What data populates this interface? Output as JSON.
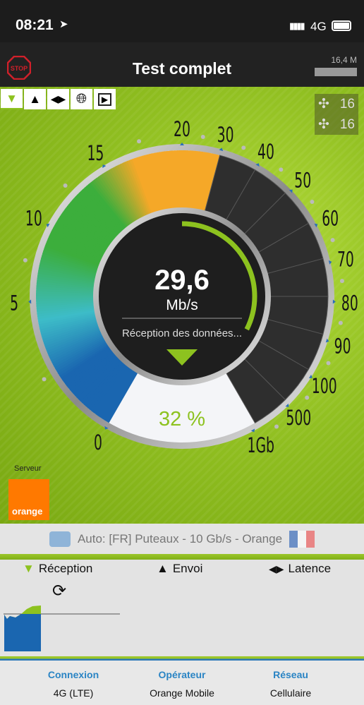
{
  "status_bar": {
    "time": "08:21",
    "network": "4G"
  },
  "header": {
    "title": "Test complet",
    "stop_label": "STOP",
    "data_used": "16,4 M"
  },
  "toolbar": {
    "icons": [
      "download-icon",
      "upload-icon",
      "latency-icon",
      "globe-icon",
      "video-icon"
    ],
    "active": "download-icon"
  },
  "counters": {
    "download_threads": "16",
    "upload_threads": "16"
  },
  "gauge": {
    "speed": "29,6",
    "unit": "Mb/s",
    "status": "Réception des données...",
    "progress": "32 %",
    "progress_fraction": 0.32,
    "scale_labels": [
      "0",
      "5",
      "10",
      "15",
      "20",
      "30",
      "40",
      "50",
      "60",
      "70",
      "80",
      "90",
      "100",
      "500",
      "1Gb"
    ],
    "colors": {
      "blue": "#1a66b0",
      "teal": "#3dbcc8",
      "green": "#3cae3c",
      "orange": "#f5a828",
      "dark": "#2e2e2e",
      "accent": "#8dc21f"
    }
  },
  "server": {
    "label": "Serveur",
    "logo_text": "orange",
    "name": "Auto: [FR] Puteaux - 10 Gb/s - Orange"
  },
  "tabs": [
    {
      "label": "Réception",
      "icon": "down-triangle-icon"
    },
    {
      "label": "Envoi",
      "icon": "up-triangle-icon"
    },
    {
      "label": "Latence",
      "icon": "latency-icon"
    }
  ],
  "info": [
    {
      "header": "Connexion",
      "value": "4G (LTE)"
    },
    {
      "header": "Opérateur",
      "value": "Orange Mobile"
    },
    {
      "header": "Réseau",
      "value": "Cellulaire"
    }
  ]
}
